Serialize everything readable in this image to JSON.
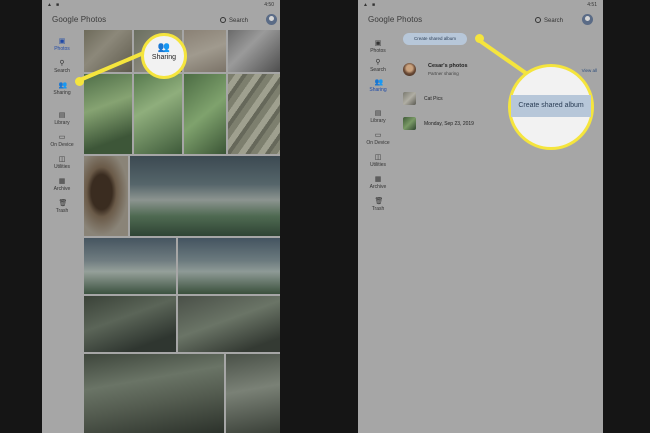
{
  "left": {
    "status_time": "4:50",
    "app_title": "Google Photos",
    "search_label": "Search",
    "nav": [
      {
        "label": "Photos",
        "icon": "photos-icon",
        "active": true
      },
      {
        "label": "Search",
        "icon": "search-icon",
        "active": false
      },
      {
        "label": "Sharing",
        "icon": "sharing-icon",
        "active": false
      },
      {
        "label": "Library",
        "icon": "library-icon",
        "active": false
      },
      {
        "label": "On Device",
        "icon": "folder-icon",
        "active": false
      },
      {
        "label": "Utilities",
        "icon": "utilities-icon",
        "active": false
      },
      {
        "label": "Archive",
        "icon": "archive-icon",
        "active": false
      },
      {
        "label": "Trash",
        "icon": "trash-icon",
        "active": false
      }
    ],
    "callout_label": "Sharing"
  },
  "right": {
    "status_time": "4:51",
    "app_title": "Google Photos",
    "search_label": "Search",
    "nav": [
      {
        "label": "Photos",
        "icon": "photos-icon",
        "active": false
      },
      {
        "label": "Search",
        "icon": "search-icon",
        "active": false
      },
      {
        "label": "Sharing",
        "icon": "sharing-icon",
        "active": true
      },
      {
        "label": "Library",
        "icon": "library-icon",
        "active": false
      },
      {
        "label": "On Device",
        "icon": "folder-icon",
        "active": false
      },
      {
        "label": "Utilities",
        "icon": "utilities-icon",
        "active": false
      },
      {
        "label": "Archive",
        "icon": "archive-icon",
        "active": false
      },
      {
        "label": "Trash",
        "icon": "trash-icon",
        "active": false
      }
    ],
    "create_button": "Create shared album",
    "partner_title": "Cesar's photos",
    "partner_sub": "Partner sharing",
    "view_all": "View all",
    "albums": [
      {
        "title": "Cat Pics"
      },
      {
        "title": "Monday, Sep 23, 2019"
      }
    ],
    "callout_label": "Create shared album"
  },
  "colors": {
    "highlight": "#f5e53d",
    "panel_bg": "#a6a6a6",
    "active_nav": "#1f4aa8",
    "background": "#151515"
  }
}
